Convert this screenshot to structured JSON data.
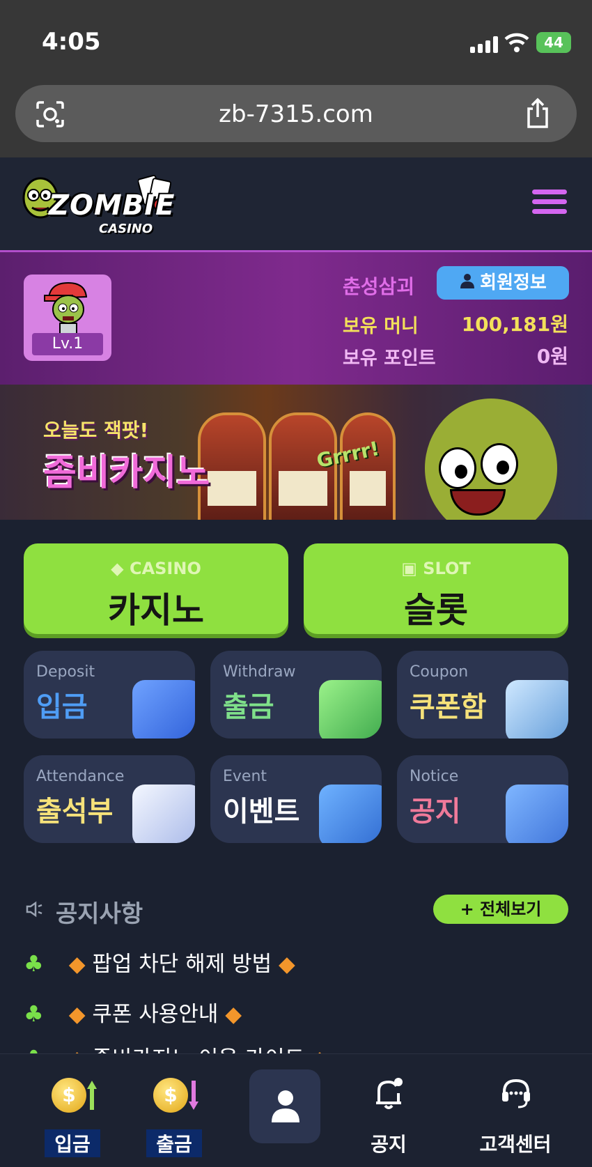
{
  "status_bar": {
    "time": "4:05",
    "battery": "44"
  },
  "browser": {
    "url": "zb-7315.com"
  },
  "header": {
    "logo_text": "ZOMBIE",
    "logo_sub": "CASINO"
  },
  "user": {
    "level": "Lv.1",
    "name": "춘성삼괴",
    "member_button": "회원정보",
    "money_label": "보유 머니",
    "money_value": "100,181원",
    "point_label": "보유 포인트",
    "point_value": "0원"
  },
  "banner": {
    "line1": "오늘도 잭팟!",
    "line2": "좀비카지노",
    "grr": "Grrrr!"
  },
  "games": [
    {
      "small": "CASINO",
      "label": "카지노"
    },
    {
      "small": "SLOT",
      "label": "슬롯"
    }
  ],
  "cards": [
    {
      "en": "Deposit",
      "ko": "입금",
      "color": "#4f9df5"
    },
    {
      "en": "Withdraw",
      "ko": "출금",
      "color": "#7fe08a"
    },
    {
      "en": "Coupon",
      "ko": "쿠폰함",
      "color": "#f6e27a"
    },
    {
      "en": "Attendance",
      "ko": "출석부",
      "color": "#f6e27a"
    },
    {
      "en": "Event",
      "ko": "이벤트",
      "color": "#ffffff"
    },
    {
      "en": "Notice",
      "ko": "공지",
      "color": "#f07a9a"
    }
  ],
  "notice": {
    "heading": "공지사항",
    "view_all": "+ 전체보기",
    "items": [
      "팝업 차단 해제 방법",
      "쿠폰 사용안내",
      "좀비카지노 이용 가이드"
    ]
  },
  "tabbar": {
    "deposit": "입금",
    "withdraw": "출금",
    "notice": "공지",
    "support": "고객센터"
  }
}
